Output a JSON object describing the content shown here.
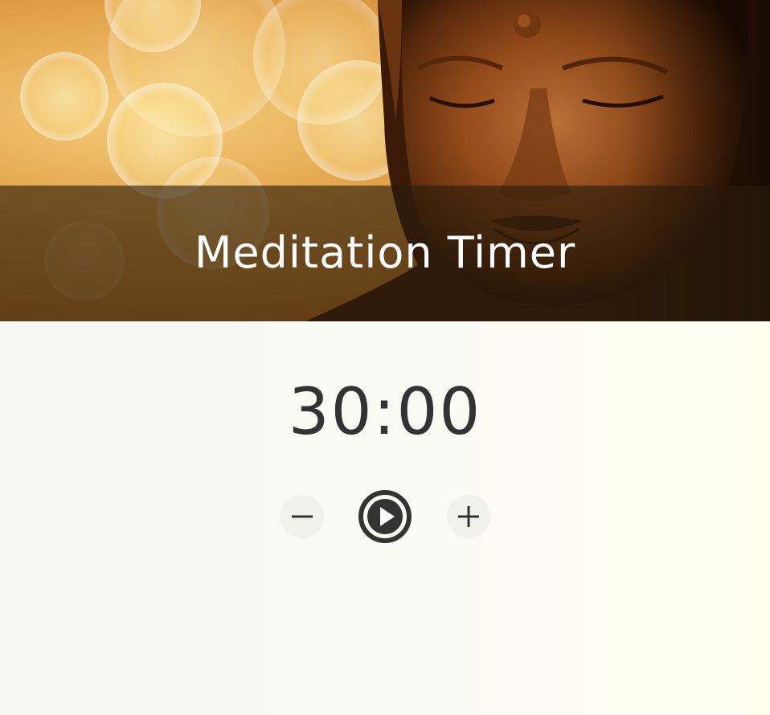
{
  "header": {
    "title": "Meditation Timer"
  },
  "timer": {
    "display": "30:00"
  },
  "controls": {
    "decrease_icon": "minus-icon",
    "play_icon": "play-circle-icon",
    "increase_icon": "plus-icon"
  },
  "colors": {
    "banner_overlay": "#281c0c",
    "title_text": "#ffffff",
    "timer_text": "#333333",
    "page_background": "#f9f9f4",
    "icon_color": "#333333"
  }
}
